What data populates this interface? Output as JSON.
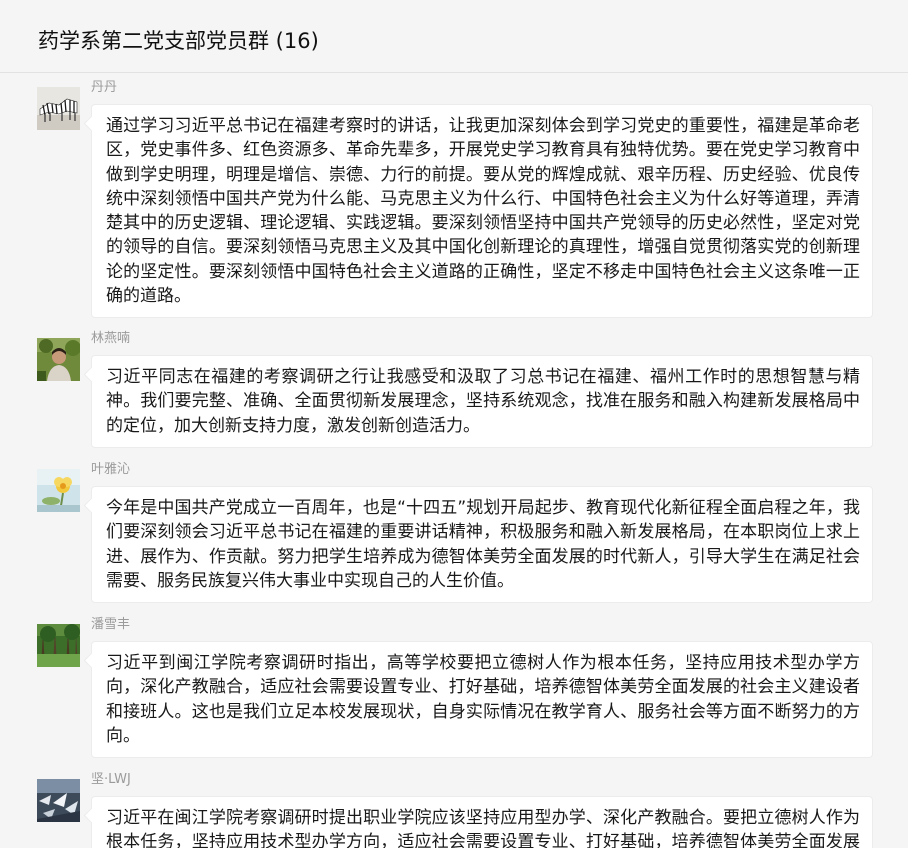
{
  "chat": {
    "title": "药学系第二党支部党员群 (16)"
  },
  "messages": [
    {
      "sender": "丹丹",
      "avatar_icon": "zebra-photo-avatar",
      "text": "通过学习习近平总书记在福建考察时的讲话，让我更加深刻体会到学习党史的重要性，福建是革命老区，党史事件多、红色资源多、革命先辈多，开展党史学习教育具有独特优势。要在党史学习教育中做到学史明理，明理是增信、崇德、力行的前提。要从党的辉煌成就、艰辛历程、历史经验、优良传统中深刻领悟中国共产党为什么能、马克思主义为什么行、中国特色社会主义为什么好等道理，弄清楚其中的历史逻辑、理论逻辑、实践逻辑。要深刻领悟坚持中国共产党领导的历史必然性，坚定对党的领导的自信。要深刻领悟马克思主义及其中国化创新理论的真理性，增强自觉贯彻落实党的创新理论的坚定性。要深刻领悟中国特色社会主义道路的正确性，坚定不移走中国特色社会主义这条唯一正确的道路。"
    },
    {
      "sender": "林燕喃",
      "avatar_icon": "person-outdoor-photo-avatar",
      "text": "习近平同志在福建的考察调研之行让我感受和汲取了习总书记在福建、福州工作时的思想智慧与精神。我们要完整、准确、全面贯彻新发展理念，坚持系统观念，找准在服务和融入构建新发展格局中的定位，加大创新支持力度，激发创新创造活力。"
    },
    {
      "sender": "叶雅沁",
      "avatar_icon": "flower-photo-avatar",
      "text": "今年是中国共产党成立一百周年，也是“十四五”规划开局起步、教育现代化新征程全面启程之年，我们要深刻领会习近平总书记在福建的重要讲话精神，积极服务和融入新发展格局，在本职岗位上求上进、展作为、作贡献。努力把学生培养成为德智体美劳全面发展的时代新人，引导大学生在满足社会需要、服务民族复兴伟大事业中实现自己的人生价值。"
    },
    {
      "sender": "潘雪丰",
      "avatar_icon": "green-forest-photo-avatar",
      "text": "习近平到闽江学院考察调研时指出，高等学校要把立德树人作为根本任务，坚持应用技术型办学方向，深化产教融合，适应社会需要设置专业、打好基础，培养德智体美劳全面发展的社会主义建设者和接班人。这也是我们立足本校发展现状，自身实际情况在教学育人、服务社会等方面不断努力的方向。"
    },
    {
      "sender": "坚·LWJ",
      "avatar_icon": "birds-photo-avatar",
      "text": "习近平在闽江学院考察调研时提出职业学院应该坚持应用型办学、深化产教融合。要把立德树人作为根本任务，坚持应用技术型办学方向，适应社会需要设置专业、打好基础，培养德智体美劳全面发展的社会主义建设者和接班人。"
    }
  ]
}
